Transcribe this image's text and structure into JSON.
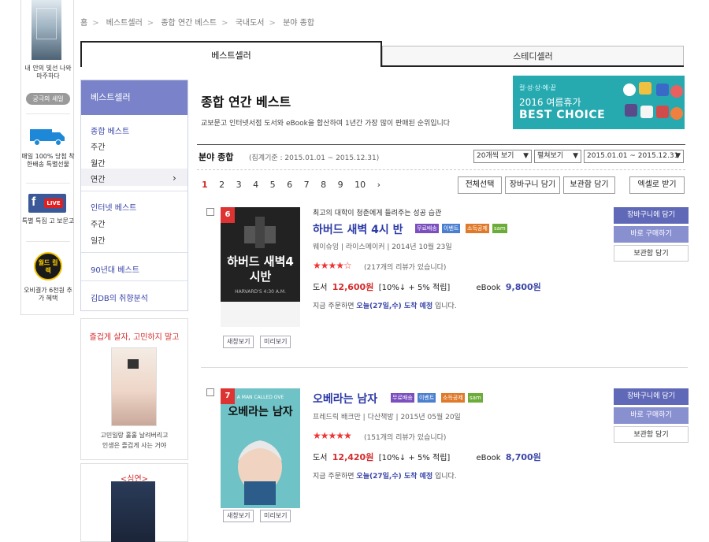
{
  "rail": {
    "book_caption": "내 안의 빛선 나와 마주하다",
    "pill": "궁극의 세일",
    "delivery_caption": "매일 100% 당첨 착한배송 특별선물",
    "fb_live": "LIVE",
    "fb_caption": "특별 특집 고 보문고",
    "event_badge": "월드 컬렉",
    "event_caption": "오비결가 6천원 추가 혜택"
  },
  "breadcrumb": [
    "홈",
    "베스트셀러",
    "종합 연간 베스트",
    "국내도서",
    "분야 종합"
  ],
  "tabs": {
    "best": "베스트셀러",
    "steady": "스테디셀러"
  },
  "nav": {
    "header": "베스트셀러",
    "group1": {
      "title": "종합 베스트",
      "items": [
        "주간",
        "월간",
        "연간"
      ]
    },
    "group2": {
      "title": "인터넷 베스트",
      "items": [
        "주간",
        "일간"
      ]
    },
    "group3": "90년대 베스트",
    "group4": "김DB의 취향분석"
  },
  "ads": {
    "ad1_title": "즐겁게 살자, 고민하지 말고",
    "ad1_line1": "고민일랑 훌훌 날려버리고",
    "ad1_line2": "인생은 즐겁게 사는 거야",
    "ad2_title": "<심연>"
  },
  "header": {
    "title": "종합 연간 베스트",
    "desc": "교보문고 인터넷서점 도서와 eBook을 합산하여 1년간 가장 많이 판매된 순위입니다",
    "banner_small": "컬·성·상·예·끝",
    "banner_mid": "2016 여름휴가",
    "banner_big": "BEST CHOICE"
  },
  "section": {
    "title": "분야 종합",
    "range": "(집계기준 : 2015.01.01 ~ 2015.12.31)",
    "select_count": "20개씩 보기",
    "select_view": "펼쳐보기",
    "select_period": "2015.01.01 ~ 2015.12.31"
  },
  "pager": {
    "pages": [
      "1",
      "2",
      "3",
      "4",
      "5",
      "6",
      "7",
      "8",
      "9",
      "10"
    ],
    "next": "›"
  },
  "actions": [
    "전체선택",
    "장바구니 담기",
    "보관함 담기",
    "엑셀로 받기"
  ],
  "items": [
    {
      "rank": "6",
      "tagline": "최고의 대학이 청춘에게 들려주는 성공 습관",
      "title": "하버드 새벽 4시 반",
      "badges": [
        "무료배송",
        "이벤트",
        "소득공제",
        "sam"
      ],
      "meta": "웨이슈잉 | 라이스메이커 | 2014년 10월 23일",
      "stars": "★★★★☆",
      "reviews": "(217개의 리뷰가 있습니다)",
      "price_label": "도서",
      "price": "12,600원",
      "discount": "[10%↓ + 5% 적립]",
      "ebook_label": "eBook",
      "ebook_price": "9,800원",
      "ship_pre": "지금 주문하면",
      "ship_hl": "오늘(27일,수) 도착 예정",
      "ship_post": "입니다.",
      "cover_title": "하버드 새벽4시반",
      "cover_sub": "HARVARD'S 4:30 A.M.",
      "btn_new": "새창보기",
      "btn_preview": "미리보기",
      "btn_cart": "장바구니에 담기",
      "btn_buy": "바로 구매하기",
      "btn_keep": "보관함 담기"
    },
    {
      "rank": "7",
      "tagline": "",
      "title": "오베라는 남자",
      "badges": [
        "무료배송",
        "이벤트",
        "소득공제",
        "sam"
      ],
      "meta": "프레드릭 배크만 | 다산책방 | 2015년 05월 20일",
      "stars": "★★★★★",
      "reviews": "(151개의 리뷰가 있습니다)",
      "price_label": "도서",
      "price": "12,420원",
      "discount": "[10%↓ + 5% 적립]",
      "ebook_label": "eBook",
      "ebook_price": "8,700원",
      "ship_pre": "지금 주문하면",
      "ship_hl": "오늘(27일,수) 도착 예정",
      "ship_post": "입니다.",
      "cover_title": "오베라는 남자",
      "cover_sub": "A MAN CALLED OVE",
      "btn_new": "새창보기",
      "btn_preview": "미리보기",
      "btn_cart": "장바구니에 담기",
      "btn_buy": "바로 구매하기",
      "btn_keep": "보관함 담기"
    }
  ]
}
